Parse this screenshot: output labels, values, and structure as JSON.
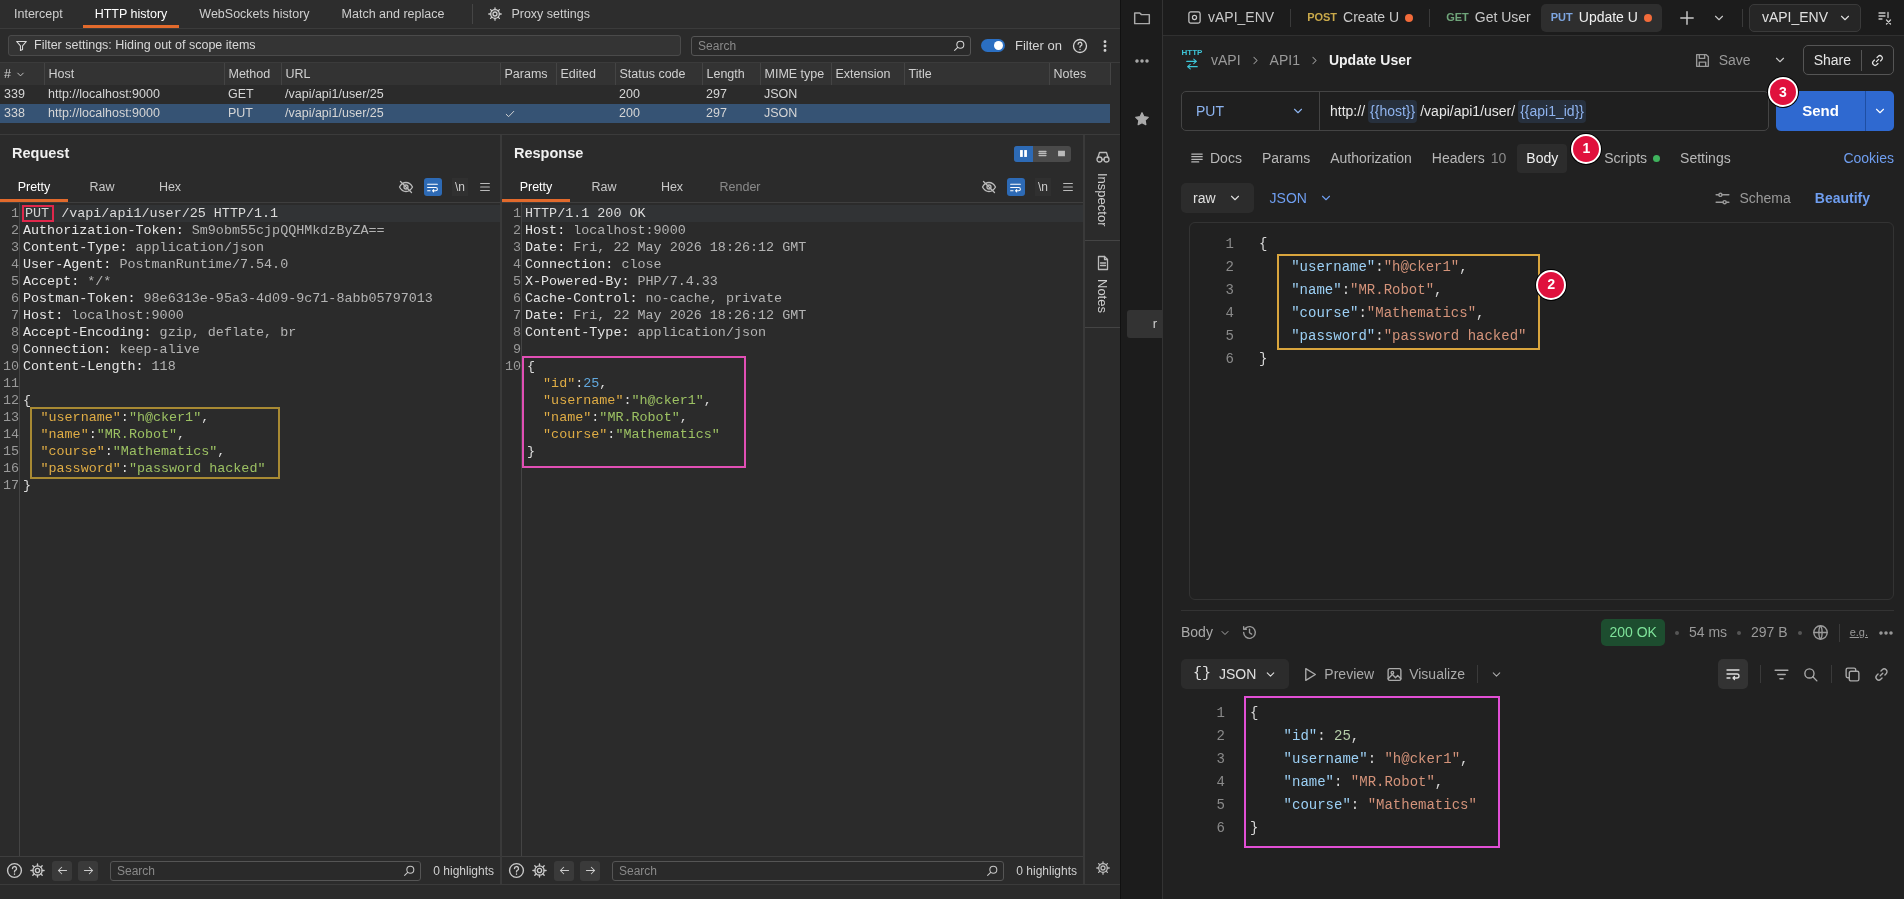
{
  "burp": {
    "tabs": [
      {
        "label": "Intercept",
        "selected": false
      },
      {
        "label": "HTTP history",
        "selected": true
      },
      {
        "label": "WebSockets history",
        "selected": false
      },
      {
        "label": "Match and replace",
        "selected": false
      }
    ],
    "settings_label": "Proxy settings",
    "filter_text": "Filter settings: Hiding out of scope items",
    "search_placeholder": "Search",
    "filter_toggle": {
      "label": "Filter on",
      "on": true
    },
    "table": {
      "columns": [
        "#",
        "Host",
        "Method",
        "URL",
        "Params",
        "Edited",
        "Status code",
        "Length",
        "MIME type",
        "Extension",
        "Title",
        "Notes"
      ],
      "rows": [
        {
          "number": "339",
          "host": "http://localhost:9000",
          "method": "GET",
          "url": "/vapi/api1/user/25",
          "params": false,
          "status_code": "200",
          "length": "297",
          "mime_type": "JSON",
          "selected": false
        },
        {
          "number": "338",
          "host": "http://localhost:9000",
          "method": "PUT",
          "url": "/vapi/api1/user/25",
          "params": true,
          "status_code": "200",
          "length": "297",
          "mime_type": "JSON",
          "selected": true
        }
      ]
    },
    "request": {
      "title": "Request",
      "tabs": [
        {
          "label": "Pretty",
          "selected": true,
          "disabled": false
        },
        {
          "label": "Raw",
          "selected": false,
          "disabled": false
        },
        {
          "label": "Hex",
          "selected": false,
          "disabled": false
        }
      ],
      "wrap_on": true,
      "newline_label": "\\n",
      "lines": [
        {
          "n": "1",
          "current": true,
          "framed": false,
          "tokens": [
            {
              "text": "PUT",
              "kind": "framed"
            },
            {
              "text": " /vapi/api1/user/25 HTTP/1.1",
              "kind": "plain"
            }
          ]
        },
        {
          "n": "2",
          "framed": false,
          "tokens": [
            {
              "text": "Authorization-Token:",
              "kind": "hname"
            },
            {
              "text": " Sm9obm55cjpQQHMkdzByZA==",
              "kind": "hval"
            }
          ]
        },
        {
          "n": "3",
          "framed": false,
          "tokens": [
            {
              "text": "Content-Type:",
              "kind": "hname"
            },
            {
              "text": " application/json",
              "kind": "hval"
            }
          ]
        },
        {
          "n": "4",
          "framed": false,
          "tokens": [
            {
              "text": "User-Agent:",
              "kind": "hname"
            },
            {
              "text": " PostmanRuntime/7.54.0",
              "kind": "hval"
            }
          ]
        },
        {
          "n": "5",
          "framed": false,
          "tokens": [
            {
              "text": "Accept:",
              "kind": "hname"
            },
            {
              "text": " */*",
              "kind": "hval"
            }
          ]
        },
        {
          "n": "6",
          "framed": false,
          "tokens": [
            {
              "text": "Postman-Token:",
              "kind": "hname"
            },
            {
              "text": " 98e6313e-95a3-4d09-9c71-8abb05797013",
              "kind": "hval"
            }
          ]
        },
        {
          "n": "7",
          "framed": false,
          "tokens": [
            {
              "text": "Host:",
              "kind": "hname"
            },
            {
              "text": " localhost:9000",
              "kind": "hval"
            }
          ]
        },
        {
          "n": "8",
          "framed": false,
          "tokens": [
            {
              "text": "Accept-Encoding:",
              "kind": "hname"
            },
            {
              "text": " gzip, deflate, br",
              "kind": "hval"
            }
          ]
        },
        {
          "n": "9",
          "framed": false,
          "tokens": [
            {
              "text": "Connection:",
              "kind": "hname"
            },
            {
              "text": " keep-alive",
              "kind": "hval"
            }
          ]
        },
        {
          "n": "10",
          "framed": false,
          "tokens": [
            {
              "text": "Content-Length:",
              "kind": "hname"
            },
            {
              "text": " 118",
              "kind": "hval"
            }
          ]
        },
        {
          "n": "11",
          "framed": false
        },
        {
          "n": "12",
          "framed": false,
          "tokens": [
            {
              "text": "{",
              "kind": "plain"
            }
          ]
        },
        {
          "n": "13",
          "framed": true,
          "tokens": [
            {
              "text": "\"username\"",
              "kind": "key"
            },
            {
              "text": ":",
              "kind": "plain"
            },
            {
              "text": "\"h@cker1\"",
              "kind": "str"
            },
            {
              "text": ",",
              "kind": "plain"
            }
          ]
        },
        {
          "n": "14",
          "framed": true,
          "tokens": [
            {
              "text": "\"name\"",
              "kind": "key"
            },
            {
              "text": ":",
              "kind": "plain"
            },
            {
              "text": "\"MR.Robot\"",
              "kind": "str"
            },
            {
              "text": ",",
              "kind": "plain"
            }
          ]
        },
        {
          "n": "15",
          "framed": true,
          "tokens": [
            {
              "text": "\"course\"",
              "kind": "key"
            },
            {
              "text": ":",
              "kind": "plain"
            },
            {
              "text": "\"Mathematics\"",
              "kind": "str"
            },
            {
              "text": ",",
              "kind": "plain"
            }
          ]
        },
        {
          "n": "16",
          "framed": true,
          "tokens": [
            {
              "text": "\"password\"",
              "kind": "key"
            },
            {
              "text": ":",
              "kind": "plain"
            },
            {
              "text": "\"password hacked\"",
              "kind": "str"
            }
          ]
        },
        {
          "n": "17",
          "framed": false,
          "tokens": [
            {
              "text": "}",
              "kind": "plain"
            }
          ]
        }
      ],
      "search_placeholder": "Search",
      "highlights": "0 highlights"
    },
    "response": {
      "title": "Response",
      "layout": [
        {
          "kind": "columns",
          "selected": true
        },
        {
          "kind": "rows",
          "selected": false
        },
        {
          "kind": "single",
          "selected": false
        }
      ],
      "tabs": [
        {
          "label": "Pretty",
          "selected": true,
          "disabled": false
        },
        {
          "label": "Raw",
          "selected": false,
          "disabled": false
        },
        {
          "label": "Hex",
          "selected": false,
          "disabled": false
        },
        {
          "label": "Render",
          "selected": false,
          "disabled": true
        }
      ],
      "wrap_on": true,
      "newline_label": "\\n",
      "lines": [
        {
          "n": "1",
          "current": true,
          "framed": false,
          "tokens": [
            {
              "text": "HTTP/1.1 200 OK",
              "kind": "plain"
            }
          ]
        },
        {
          "n": "2",
          "framed": false,
          "tokens": [
            {
              "text": "Host:",
              "kind": "hname"
            },
            {
              "text": " localhost:9000",
              "kind": "hval"
            }
          ]
        },
        {
          "n": "3",
          "framed": false,
          "tokens": [
            {
              "text": "Date:",
              "kind": "hname"
            },
            {
              "text": " Fri, 22 May 2026 18:26:12 GMT",
              "kind": "hval"
            }
          ]
        },
        {
          "n": "4",
          "framed": false,
          "tokens": [
            {
              "text": "Connection:",
              "kind": "hname"
            },
            {
              "text": " close",
              "kind": "hval"
            }
          ]
        },
        {
          "n": "5",
          "framed": false,
          "tokens": [
            {
              "text": "X-Powered-By:",
              "kind": "hname"
            },
            {
              "text": " PHP/7.4.33",
              "kind": "hval"
            }
          ]
        },
        {
          "n": "6",
          "framed": false,
          "tokens": [
            {
              "text": "Cache-Control:",
              "kind": "hname"
            },
            {
              "text": " no-cache, private",
              "kind": "hval"
            }
          ]
        },
        {
          "n": "7",
          "framed": false,
          "tokens": [
            {
              "text": "Date:",
              "kind": "hname"
            },
            {
              "text": " Fri, 22 May 2026 18:26:12 GMT",
              "kind": "hval"
            }
          ]
        },
        {
          "n": "8",
          "framed": false,
          "tokens": [
            {
              "text": "Content-Type:",
              "kind": "hname"
            },
            {
              "text": " application/json",
              "kind": "hval"
            }
          ]
        },
        {
          "n": "9",
          "framed": false
        },
        {
          "n": "10",
          "framed": true,
          "tokens": [
            {
              "text": "{",
              "kind": "plain"
            }
          ]
        },
        {
          "framed": true,
          "tokens": [
            {
              "text": "  \"id\"",
              "kind": "key"
            },
            {
              "text": ":",
              "kind": "plain"
            },
            {
              "text": "25",
              "kind": "num"
            },
            {
              "text": ",",
              "kind": "plain"
            }
          ]
        },
        {
          "framed": true,
          "tokens": [
            {
              "text": "  \"username\"",
              "kind": "key"
            },
            {
              "text": ":",
              "kind": "plain"
            },
            {
              "text": "\"h@cker1\"",
              "kind": "str"
            },
            {
              "text": ",",
              "kind": "plain"
            }
          ]
        },
        {
          "framed": true,
          "tokens": [
            {
              "text": "  \"name\"",
              "kind": "key"
            },
            {
              "text": ":",
              "kind": "plain"
            },
            {
              "text": "\"MR.Robot\"",
              "kind": "str"
            },
            {
              "text": ",",
              "kind": "plain"
            }
          ]
        },
        {
          "framed": true,
          "tokens": [
            {
              "text": "  \"course\"",
              "kind": "key"
            },
            {
              "text": ":",
              "kind": "plain"
            },
            {
              "text": "\"Mathematics\"",
              "kind": "str"
            }
          ]
        },
        {
          "framed": true,
          "tokens": [
            {
              "text": "}",
              "kind": "plain"
            }
          ]
        }
      ],
      "search_placeholder": "Search",
      "highlights": "0 highlights"
    },
    "side_tabs": [
      "Inspector",
      "Notes"
    ]
  },
  "postman": {
    "sidebar_fragment": "r",
    "tabs": [
      {
        "kind": "environment",
        "label": "vAPI_ENV",
        "unsaved": false,
        "selected": false
      },
      {
        "kind": "request",
        "method": "POST",
        "color": "#c9a94a",
        "label": "Create U",
        "unsaved": true,
        "selected": false
      },
      {
        "kind": "request",
        "method": "GET",
        "color": "#6fa57a",
        "label": "Get User",
        "unsaved": false,
        "selected": false
      },
      {
        "kind": "request",
        "method": "PUT",
        "color": "#7ea6e0",
        "label": "Update U",
        "unsaved": true,
        "selected": true
      }
    ],
    "environment": "vAPI_ENV",
    "http_icon_label": "HTTP",
    "breadcrumb": [
      "vAPI",
      "API1",
      "Update User"
    ],
    "save_label": "Save",
    "share_label": "Share",
    "method": "PUT",
    "url": [
      {
        "text": "http://",
        "kind": "text"
      },
      {
        "text": "{{host}}",
        "kind": "variable"
      },
      {
        "text": "/vapi/api1/user/",
        "kind": "text"
      },
      {
        "text": "{{api1_id}}",
        "kind": "variable"
      }
    ],
    "send": {
      "label": "Send",
      "callout": "3"
    },
    "request_tabs": [
      {
        "label": "Docs",
        "kind": "docs",
        "selected": false
      },
      {
        "label": "Params",
        "kind": "plain",
        "selected": false
      },
      {
        "label": "Authorization",
        "kind": "plain",
        "selected": false
      },
      {
        "label": "Headers",
        "kind": "count",
        "count": "10",
        "selected": false
      },
      {
        "label": "Body",
        "kind": "plain",
        "selected": true,
        "callout": "1"
      },
      {
        "label": "Scripts",
        "kind": "indicator",
        "selected": false
      },
      {
        "label": "Settings",
        "kind": "plain",
        "selected": false
      }
    ],
    "cookies": "Cookies",
    "body_mode": "raw",
    "body_language": "JSON",
    "schema_label": "Schema",
    "beautify_label": "Beautify",
    "body_callout": "2",
    "body_lines": [
      {
        "n": "1",
        "framed": false,
        "tokens": [
          {
            "text": "{",
            "kind": "punct"
          }
        ]
      },
      {
        "n": "2",
        "framed": true,
        "tokens": [
          {
            "text": "\"username\"",
            "kind": "key"
          },
          {
            "text": ":",
            "kind": "punct"
          },
          {
            "text": "\"h@cker1\"",
            "kind": "str"
          },
          {
            "text": ",",
            "kind": "punct"
          }
        ]
      },
      {
        "n": "3",
        "framed": true,
        "tokens": [
          {
            "text": "\"name\"",
            "kind": "key"
          },
          {
            "text": ":",
            "kind": "punct"
          },
          {
            "text": "\"MR.Robot\"",
            "kind": "str"
          },
          {
            "text": ",",
            "kind": "punct"
          }
        ]
      },
      {
        "n": "4",
        "framed": true,
        "tokens": [
          {
            "text": "\"course\"",
            "kind": "key"
          },
          {
            "text": ":",
            "kind": "punct"
          },
          {
            "text": "\"Mathematics\"",
            "kind": "str"
          },
          {
            "text": ",",
            "kind": "punct"
          }
        ]
      },
      {
        "n": "5",
        "framed": true,
        "tokens": [
          {
            "text": "\"password\"",
            "kind": "key"
          },
          {
            "text": ":",
            "kind": "punct"
          },
          {
            "text": "\"password hacked\"",
            "kind": "str"
          }
        ]
      },
      {
        "n": "6",
        "framed": false,
        "tokens": [
          {
            "text": "}",
            "kind": "punct"
          }
        ]
      }
    ],
    "response": {
      "view": "Body",
      "status": "200 OK",
      "time": "54 ms",
      "size": "297 B",
      "example_label": "e.g.",
      "format": {
        "glyph": "{}",
        "label": "JSON"
      },
      "preview_label": "Preview",
      "visualize_label": "Visualize",
      "framed": true,
      "lines": [
        {
          "n": "1",
          "tokens": [
            {
              "text": "{",
              "kind": "punct"
            }
          ]
        },
        {
          "n": "2",
          "tokens": [
            {
              "text": "    \"id\"",
              "kind": "key"
            },
            {
              "text": ": ",
              "kind": "punct"
            },
            {
              "text": "25",
              "kind": "num"
            },
            {
              "text": ",",
              "kind": "punct"
            }
          ]
        },
        {
          "n": "3",
          "tokens": [
            {
              "text": "    \"username\"",
              "kind": "key"
            },
            {
              "text": ": ",
              "kind": "punct"
            },
            {
              "text": "\"h@cker1\"",
              "kind": "str"
            },
            {
              "text": ",",
              "kind": "punct"
            }
          ]
        },
        {
          "n": "4",
          "tokens": [
            {
              "text": "    \"name\"",
              "kind": "key"
            },
            {
              "text": ": ",
              "kind": "punct"
            },
            {
              "text": "\"MR.Robot\"",
              "kind": "str"
            },
            {
              "text": ",",
              "kind": "punct"
            }
          ]
        },
        {
          "n": "5",
          "tokens": [
            {
              "text": "    \"course\"",
              "kind": "key"
            },
            {
              "text": ": ",
              "kind": "punct"
            },
            {
              "text": "\"Mathematics\"",
              "kind": "str"
            }
          ]
        },
        {
          "n": "6",
          "tokens": [
            {
              "text": "}",
              "kind": "punct"
            }
          ]
        }
      ]
    }
  }
}
